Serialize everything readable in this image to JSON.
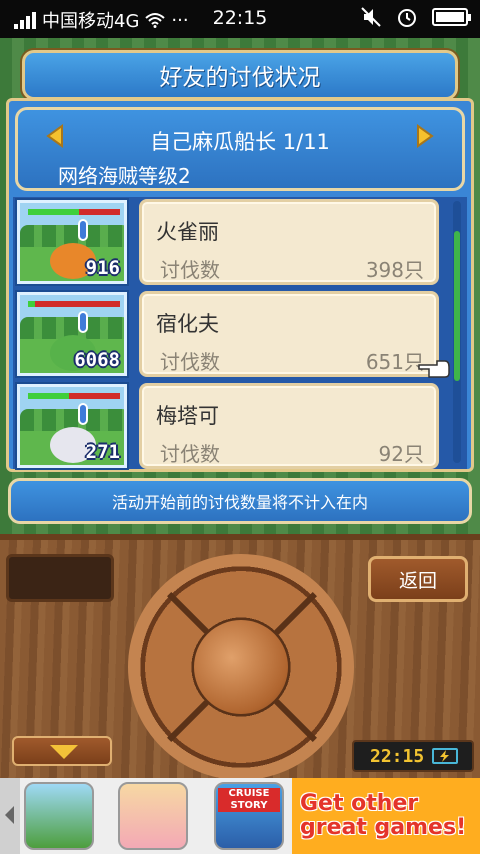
{
  "status_bar": {
    "carrier": "中国移动4G",
    "dots": "···",
    "time": "22:15",
    "icons": [
      "signal-icon",
      "wifi-icon",
      "mute-icon",
      "alarm-icon",
      "battery-icon"
    ]
  },
  "dialog": {
    "title": "好友的讨伐状况",
    "captain": "自己麻瓜船长 1/11",
    "pirate_level": "网络海贼等级2"
  },
  "monsters": [
    {
      "name": "火雀丽",
      "label": "讨伐数",
      "value": "398只",
      "count": "916",
      "hp_fraction": 0.55,
      "color": "#e8872a"
    },
    {
      "name": "宿化夫",
      "label": "讨伐数",
      "value": "651只",
      "count": "6068",
      "hp_fraction": 0.08,
      "color": "#57b24a"
    },
    {
      "name": "梅塔可",
      "label": "讨伐数",
      "value": "92只",
      "count": "271",
      "hp_fraction": 0.45,
      "color": "#e6e6ee"
    }
  ],
  "notice": "活动开始前的讨伐数量将不计入在内",
  "controls": {
    "back_label": "返回",
    "clock": "22:15"
  },
  "ad": {
    "icon3_label": "CRUISE STORY",
    "cta_line1": "Get other",
    "cta_line2": "great games!"
  }
}
